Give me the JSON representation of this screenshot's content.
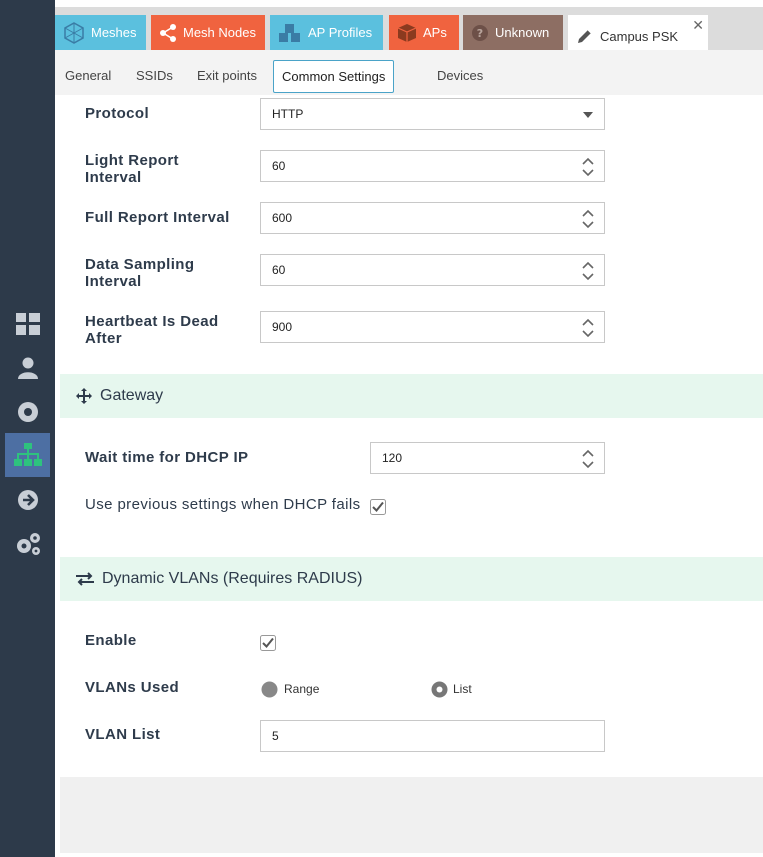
{
  "sidebar": {
    "items": [
      {
        "icon": "dashboard-icon"
      },
      {
        "icon": "user-icon"
      },
      {
        "icon": "target-icon"
      },
      {
        "icon": "network-tree-icon",
        "active": true
      },
      {
        "icon": "arrow-right-circle-icon"
      },
      {
        "icon": "gears-icon"
      }
    ]
  },
  "tabs": [
    {
      "label": "Meshes",
      "icon": "mesh-icon",
      "color": "#5bc0de"
    },
    {
      "label": "Mesh Nodes",
      "icon": "share-icon",
      "color": "#f0633f"
    },
    {
      "label": "AP Profiles",
      "icon": "cubes-icon",
      "color": "#5bc0de"
    },
    {
      "label": "APs",
      "icon": "cube-icon",
      "color": "#f0633f"
    },
    {
      "label": "Unknown",
      "icon": "question-icon",
      "color": "#8d6e63"
    },
    {
      "label": "Campus PSK",
      "icon": "pencil-icon",
      "active": true,
      "close": "✕"
    }
  ],
  "subtabs": [
    {
      "label": "General"
    },
    {
      "label": "SSIDs"
    },
    {
      "label": "Exit points"
    },
    {
      "label": "Common Settings",
      "active": true
    },
    {
      "label": "Devices"
    }
  ],
  "form": {
    "protocol": {
      "label": "Protocol",
      "value": "HTTP"
    },
    "light_report": {
      "label": "Light Report Interval",
      "value": "60"
    },
    "full_report": {
      "label": "Full Report Interval",
      "value": "600"
    },
    "data_sampling": {
      "label": "Data Sampling Interval",
      "value": "60"
    },
    "heartbeat": {
      "label": "Heartbeat Is Dead After",
      "value": "900"
    }
  },
  "gateway": {
    "title": "Gateway",
    "wait_dhcp": {
      "label": "Wait time for DHCP IP",
      "value": "120"
    },
    "prev_settings": {
      "label": "Use previous settings when DHCP fails",
      "checked": true
    }
  },
  "vlans": {
    "title": "Dynamic VLANs (Requires RADIUS)",
    "enable": {
      "label": "Enable",
      "checked": true
    },
    "used": {
      "label": "VLANs Used",
      "options": [
        "Range",
        "List"
      ],
      "selected": "List"
    },
    "list": {
      "label": "VLAN List",
      "value": "5"
    }
  },
  "colors": {
    "sidebar": "#2d3a4a",
    "sidebar_active": "#4d6fa3",
    "section_bg": "#e6f7ee",
    "label": "#2e3b4b",
    "accent": "#4aa3c8"
  }
}
